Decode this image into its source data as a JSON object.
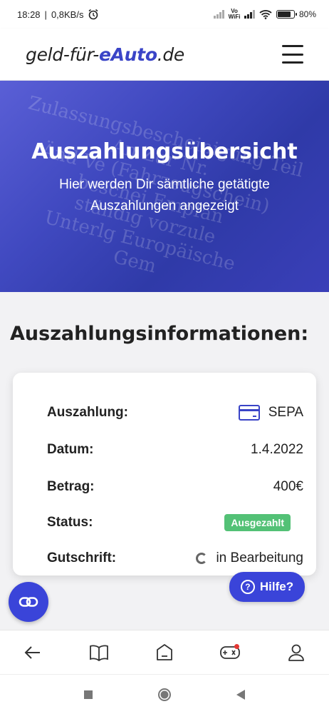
{
  "status_bar": {
    "time": "18:28",
    "speed": "0,8KB/s",
    "network_label_top": "Vo",
    "network_label_bottom": "WiFi",
    "battery": "80%",
    "battery_level": 0.8
  },
  "header": {
    "logo_prefix": "geld-für-",
    "logo_accent": "eAuto",
    "logo_suffix": ".de"
  },
  "hero": {
    "title": "Auszahlungsübersicht",
    "subtitle": "Hier werden Dir sämtliche getätigte Auszahlungen angezeigt"
  },
  "section": {
    "title": "Auszahlungsinformationen:"
  },
  "details": {
    "payout_label": "Auszahlung:",
    "payout_value": "SEPA",
    "date_label": "Datum:",
    "date_value": "1.4.2022",
    "amount_label": "Betrag:",
    "amount_value": "400€",
    "status_label": "Status:",
    "status_value": "Ausgezahlt",
    "credit_label": "Gutschrift:",
    "credit_value": "in Bearbeitung"
  },
  "help": {
    "label": "Hilfe?"
  },
  "colors": {
    "brand": "#3a44d9",
    "status_paid": "#53c176"
  },
  "icons": {
    "nav": [
      "arrow-left-icon",
      "book-icon",
      "home-icon",
      "gamepad-icon",
      "user-icon"
    ],
    "system": [
      "square-icon",
      "circle-icon",
      "triangle-back-icon"
    ]
  }
}
